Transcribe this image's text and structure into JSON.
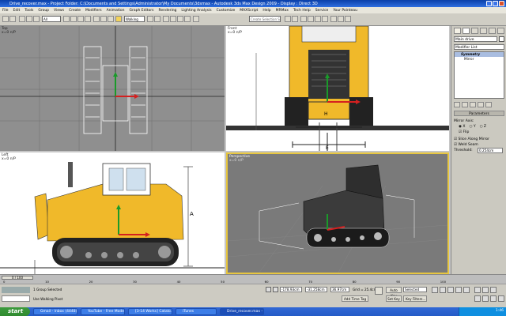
{
  "window": {
    "title": "Drive_recover.max     - Project Folder: C:\\Documents and Settings\\Administrator\\My Documents\\3dsmax     - Autodesk 3ds Max Design 2009     - Display : Direct 3D"
  },
  "menu": [
    "File",
    "Edit",
    "Tools",
    "Group",
    "Views",
    "Create",
    "Modifiers",
    "Animation",
    "Graph Editors",
    "Rendering",
    "Lighting Analysis",
    "Customize",
    "MAXScript",
    "Help",
    "MRMax",
    "Tech Help",
    "Service",
    "Your Pointeau"
  ],
  "toolbar": {
    "filter_value": "All",
    "refcoord_value": "Walking",
    "selection_set_placeholder": "Create Selection Set"
  },
  "viewports": {
    "top": {
      "label": "Top",
      "sublabel": "x=0 n/P"
    },
    "front": {
      "label": "Front",
      "sublabel": "x=0 n/P"
    },
    "left": {
      "label": "Left",
      "sublabel": "x=0 n/P"
    },
    "perspective": {
      "label": "Perspective",
      "sublabel": "x=0 n/P"
    },
    "dims": {
      "h": "H",
      "e": "E",
      "a": "A"
    }
  },
  "command_panel": {
    "object_name": "Main drive",
    "modifier_list": "Modifier List",
    "stack": [
      "Symmetry",
      "Mirror"
    ],
    "rollout": "Parameters",
    "mirror_axis_label": "Mirror Axis:",
    "axes": [
      "X",
      "Y",
      "Z"
    ],
    "flip": "Flip",
    "slice": "Slice Along Mirror",
    "weld": "Weld Seam",
    "threshold_label": "Threshold:",
    "threshold_value": "0.254cm"
  },
  "time": {
    "frame": "0 / 100",
    "ticks": [
      "0",
      "10",
      "20",
      "30",
      "40",
      "50",
      "60",
      "70",
      "80",
      "90",
      "100"
    ]
  },
  "status": {
    "selected": "1 Group Selected",
    "prompt": "Use Walking Pivot",
    "x": "-178.93cm",
    "y": "-31.258cm",
    "z": "36.97cm",
    "grid": "Grid = 25.4cm",
    "add_time_tag": "Add Time Tag",
    "auto_key": "Auto Key",
    "set_key": "Set Key",
    "selected_dd": "Selected",
    "key_filters": "Key Filters..."
  },
  "taskbar": {
    "start": "start",
    "tasks": [
      "Gmail - Inbox (4448)...",
      "YouTube - Free Models...",
      "[3-14 Works] Catalo...",
      "iTunes",
      "Drive_recover.max - ..."
    ],
    "clock": "1:46"
  },
  "colors": {
    "yellow": "#f0b92a",
    "viewport_dark": "#8f8f8f",
    "active_border": "#e7c640"
  }
}
